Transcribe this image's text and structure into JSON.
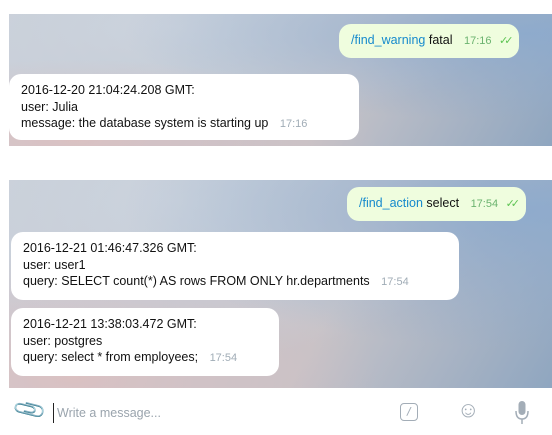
{
  "chat1": {
    "outgoing": {
      "command": "/find_warning",
      "argument": "fatal",
      "time": "17:16",
      "status_icon": "double-check-icon"
    },
    "incoming": {
      "lines": [
        "2016-12-20 21:04:24.208 GMT:",
        "user: Julia",
        "message: the database system is starting up"
      ],
      "time": "17:16"
    }
  },
  "chat2": {
    "outgoing": {
      "command": "/find_action",
      "argument": "select",
      "time": "17:54",
      "status_icon": "double-check-icon"
    },
    "incoming": [
      {
        "lines": [
          "2016-12-21 01:46:47.326 GMT:",
          "user: user1",
          "query: SELECT count(*) AS rows FROM ONLY hr.departments"
        ],
        "time": "17:54"
      },
      {
        "lines": [
          "2016-12-21 13:38:03.472 GMT:",
          "user: postgres",
          "query: select * from employees;"
        ],
        "time": "17:54"
      }
    ]
  },
  "composer": {
    "placeholder": "Write a message...",
    "icons": [
      "paperclip-icon",
      "bot-command-icon",
      "emoji-icon",
      "microphone-icon"
    ]
  }
}
